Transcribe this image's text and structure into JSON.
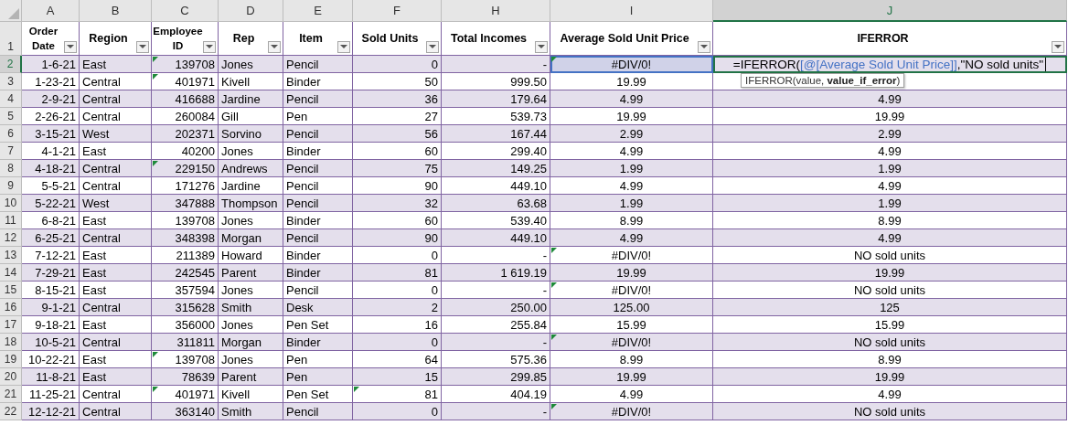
{
  "columns": [
    {
      "letter": "A",
      "selected": false
    },
    {
      "letter": "B",
      "selected": false
    },
    {
      "letter": "C",
      "selected": false
    },
    {
      "letter": "D",
      "selected": false
    },
    {
      "letter": "E",
      "selected": false
    },
    {
      "letter": "F",
      "selected": false
    },
    {
      "letter": "H",
      "selected": false
    },
    {
      "letter": "I",
      "selected": false
    },
    {
      "letter": "J",
      "selected": true
    }
  ],
  "header": {
    "num": "1",
    "labels": [
      "Order Date",
      "Region",
      "Employee ID",
      "Rep",
      "Item",
      "Sold Units",
      "Total Incomes",
      "Average Sold Unit Price",
      "IFERROR"
    ]
  },
  "rows": [
    {
      "num": "2",
      "selected": true,
      "cells": [
        "1-6-21",
        "East",
        "139708",
        "Jones",
        "Pencil",
        "0",
        "-",
        "#DIV/0!"
      ],
      "flags": [
        false,
        false,
        true,
        false,
        false,
        false,
        false,
        true
      ],
      "formula": [
        {
          "kind": "plain",
          "text": "=IFERROR("
        },
        {
          "kind": "ref",
          "text": "[@[Average Sold Unit Price]]"
        },
        {
          "kind": "plain",
          "text": ",\"NO sold units\""
        }
      ],
      "tooltip": "IFERROR(value, **value_if_error**)"
    },
    {
      "num": "3",
      "selected": false,
      "cells": [
        "1-23-21",
        "Central",
        "401971",
        "Kivell",
        "Binder",
        "50",
        "999.50",
        "19.99"
      ],
      "flags": [
        false,
        false,
        true,
        false,
        false,
        false,
        false,
        false
      ]
    },
    {
      "num": "4",
      "selected": false,
      "cells": [
        "2-9-21",
        "Central",
        "416688",
        "Jardine",
        "Pencil",
        "36",
        "179.64",
        "4.99",
        "4.99"
      ],
      "flags": [
        false,
        false,
        false,
        false,
        false,
        false,
        false,
        false
      ]
    },
    {
      "num": "5",
      "selected": false,
      "cells": [
        "2-26-21",
        "Central",
        "260084",
        "Gill",
        "Pen",
        "27",
        "539.73",
        "19.99",
        "19.99"
      ],
      "flags": [
        false,
        false,
        false,
        false,
        false,
        false,
        false,
        false
      ]
    },
    {
      "num": "6",
      "selected": false,
      "cells": [
        "3-15-21",
        "West",
        "202371",
        "Sorvino",
        "Pencil",
        "56",
        "167.44",
        "2.99",
        "2.99"
      ],
      "flags": [
        false,
        false,
        false,
        false,
        false,
        false,
        false,
        false
      ]
    },
    {
      "num": "7",
      "selected": false,
      "cells": [
        "4-1-21",
        "East",
        "40200",
        "Jones",
        "Binder",
        "60",
        "299.40",
        "4.99",
        "4.99"
      ],
      "flags": [
        false,
        false,
        false,
        false,
        false,
        false,
        false,
        false
      ]
    },
    {
      "num": "8",
      "selected": false,
      "cells": [
        "4-18-21",
        "Central",
        "229150",
        "Andrews",
        "Pencil",
        "75",
        "149.25",
        "1.99",
        "1.99"
      ],
      "flags": [
        false,
        false,
        true,
        false,
        false,
        false,
        false,
        false
      ]
    },
    {
      "num": "9",
      "selected": false,
      "cells": [
        "5-5-21",
        "Central",
        "171276",
        "Jardine",
        "Pencil",
        "90",
        "449.10",
        "4.99",
        "4.99"
      ],
      "flags": [
        false,
        false,
        false,
        false,
        false,
        false,
        false,
        false
      ]
    },
    {
      "num": "10",
      "selected": false,
      "cells": [
        "5-22-21",
        "West",
        "347888",
        "Thompson",
        "Pencil",
        "32",
        "63.68",
        "1.99",
        "1.99"
      ],
      "flags": [
        false,
        false,
        false,
        false,
        false,
        false,
        false,
        false
      ]
    },
    {
      "num": "11",
      "selected": false,
      "cells": [
        "6-8-21",
        "East",
        "139708",
        "Jones",
        "Binder",
        "60",
        "539.40",
        "8.99",
        "8.99"
      ],
      "flags": [
        false,
        false,
        false,
        false,
        false,
        false,
        false,
        false
      ]
    },
    {
      "num": "12",
      "selected": false,
      "cells": [
        "6-25-21",
        "Central",
        "348398",
        "Morgan",
        "Pencil",
        "90",
        "449.10",
        "4.99",
        "4.99"
      ],
      "flags": [
        false,
        false,
        false,
        false,
        false,
        false,
        false,
        false
      ]
    },
    {
      "num": "13",
      "selected": false,
      "cells": [
        "7-12-21",
        "East",
        "211389",
        "Howard",
        "Binder",
        "0",
        "-",
        "#DIV/0!",
        "NO sold units"
      ],
      "flags": [
        false,
        false,
        false,
        false,
        false,
        false,
        false,
        true
      ]
    },
    {
      "num": "14",
      "selected": false,
      "cells": [
        "7-29-21",
        "East",
        "242545",
        "Parent",
        "Binder",
        "81",
        "1 619.19",
        "19.99",
        "19.99"
      ],
      "flags": [
        false,
        false,
        false,
        false,
        false,
        false,
        false,
        false
      ]
    },
    {
      "num": "15",
      "selected": false,
      "cells": [
        "8-15-21",
        "East",
        "357594",
        "Jones",
        "Pencil",
        "0",
        "-",
        "#DIV/0!",
        "NO sold units"
      ],
      "flags": [
        false,
        false,
        false,
        false,
        false,
        false,
        false,
        true
      ]
    },
    {
      "num": "16",
      "selected": false,
      "cells": [
        "9-1-21",
        "Central",
        "315628",
        "Smith",
        "Desk",
        "2",
        "250.00",
        "125.00",
        "125"
      ],
      "flags": [
        false,
        false,
        false,
        false,
        false,
        false,
        false,
        false
      ]
    },
    {
      "num": "17",
      "selected": false,
      "cells": [
        "9-18-21",
        "East",
        "356000",
        "Jones",
        "Pen Set",
        "16",
        "255.84",
        "15.99",
        "15.99"
      ],
      "flags": [
        false,
        false,
        false,
        false,
        false,
        false,
        false,
        false
      ]
    },
    {
      "num": "18",
      "selected": false,
      "cells": [
        "10-5-21",
        "Central",
        "311811",
        "Morgan",
        "Binder",
        "0",
        "-",
        "#DIV/0!",
        "NO sold units"
      ],
      "flags": [
        false,
        false,
        false,
        false,
        false,
        false,
        false,
        true
      ]
    },
    {
      "num": "19",
      "selected": false,
      "cells": [
        "10-22-21",
        "East",
        "139708",
        "Jones",
        "Pen",
        "64",
        "575.36",
        "8.99",
        "8.99"
      ],
      "flags": [
        false,
        false,
        true,
        false,
        false,
        false,
        false,
        false
      ]
    },
    {
      "num": "20",
      "selected": false,
      "cells": [
        "11-8-21",
        "East",
        "78639",
        "Parent",
        "Pen",
        "15",
        "299.85",
        "19.99",
        "19.99"
      ],
      "flags": [
        false,
        false,
        false,
        false,
        false,
        false,
        false,
        false
      ]
    },
    {
      "num": "21",
      "selected": false,
      "cells": [
        "11-25-21",
        "Central",
        "401971",
        "Kivell",
        "Pen Set",
        "81",
        "404.19",
        "4.99",
        "4.99"
      ],
      "flags": [
        false,
        false,
        true,
        false,
        false,
        true,
        false,
        false
      ]
    },
    {
      "num": "22",
      "selected": false,
      "cells": [
        "12-12-21",
        "Central",
        "363140",
        "Smith",
        "Pencil",
        "0",
        "-",
        "#DIV/0!",
        "NO sold units"
      ],
      "flags": [
        false,
        false,
        false,
        false,
        false,
        false,
        false,
        true
      ]
    }
  ]
}
